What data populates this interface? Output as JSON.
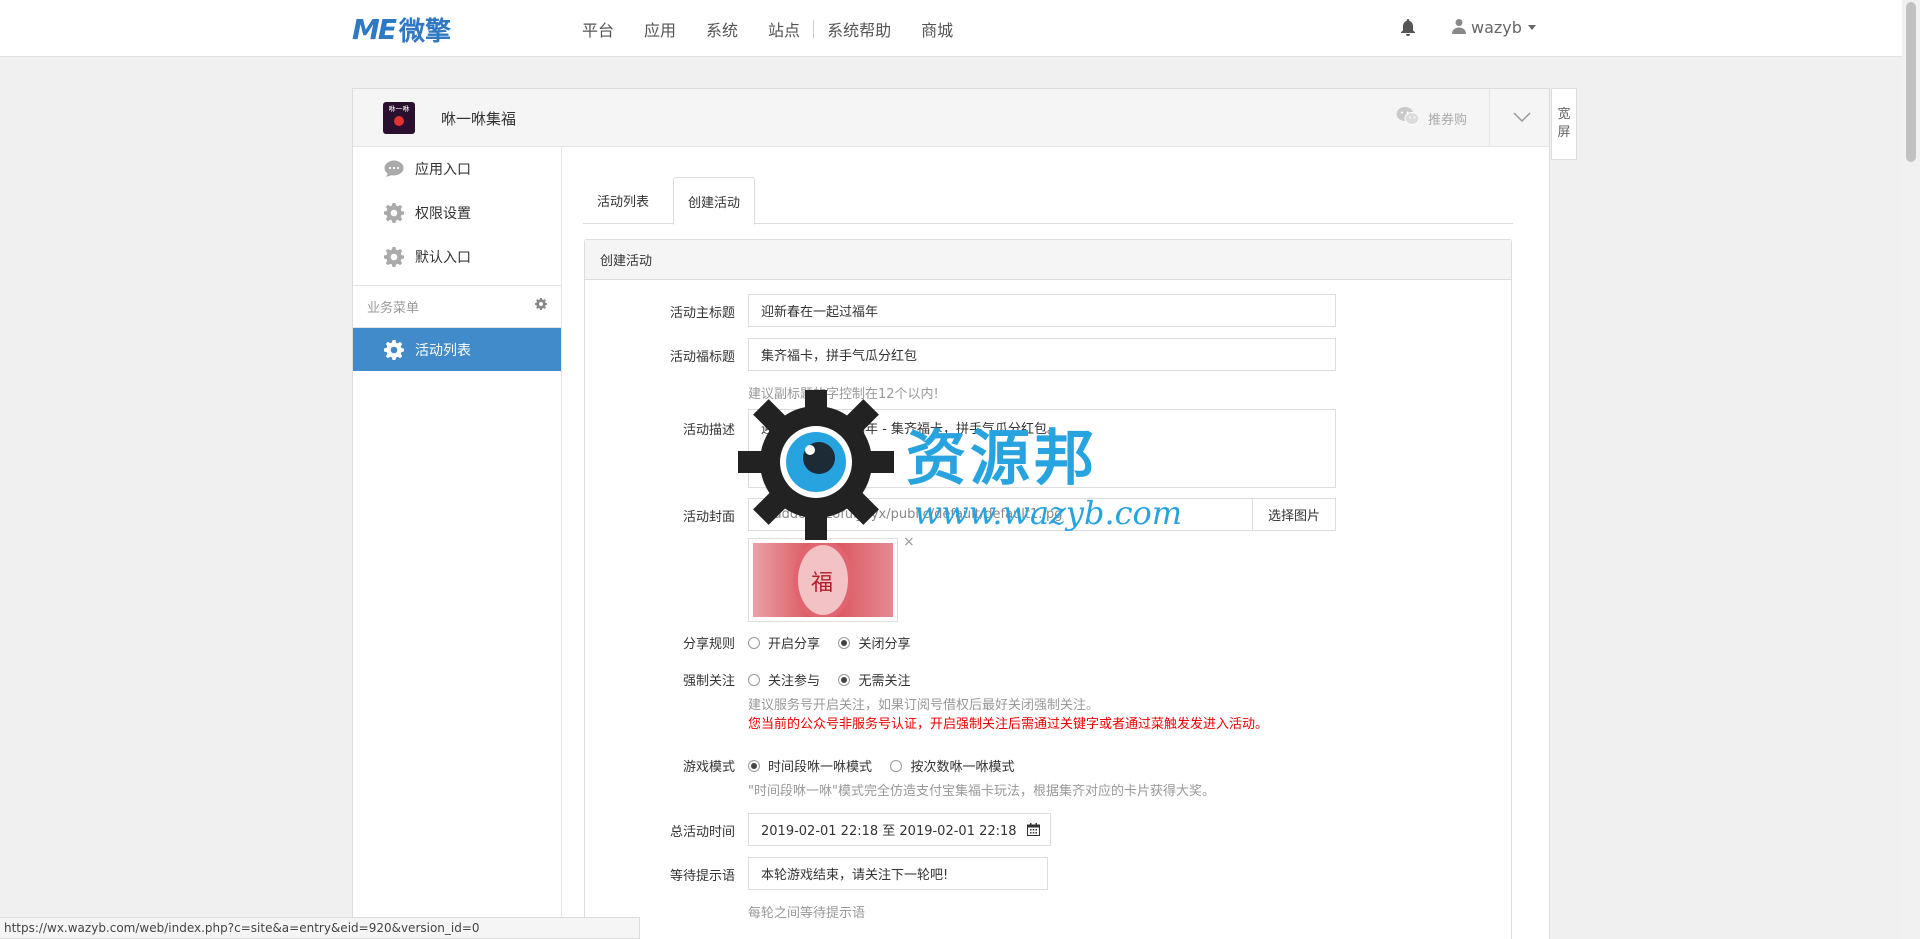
{
  "brand": {
    "mark": "ME",
    "name": "微擎"
  },
  "nav": [
    "平台",
    "应用",
    "系统",
    "站点",
    "系统帮助",
    "商城"
  ],
  "user": {
    "name": "wazyb"
  },
  "app": {
    "title": "咻一咻集福",
    "icon_text": "咻一咻",
    "recommend": "推券购"
  },
  "wide_screen": [
    "宽",
    "屏"
  ],
  "sidebar": {
    "items": [
      {
        "label": "应用入口",
        "icon": "chat-icon"
      },
      {
        "label": "权限设置",
        "icon": "gear-icon"
      },
      {
        "label": "默认入口",
        "icon": "gear-icon"
      }
    ],
    "group_title": "业务菜单",
    "active_item": "活动列表"
  },
  "tabs": [
    "活动列表",
    "创建活动"
  ],
  "form": {
    "card_title": "创建活动",
    "main_title_label": "活动主标题",
    "main_title_value": "迎新春在一起过福年",
    "sub_title_label": "活动福标题",
    "sub_title_value": "集齐福卡，拼手气瓜分红包",
    "sub_title_help": "建议副标题的字控制在12个以内!",
    "desc_label": "活动描述",
    "desc_value": "迎新春在一起过福年 - 集齐福卡，拼手气瓜分红包。",
    "cover_label": "活动封面",
    "cover_value": "../addons/zofui_xyx/public/default/default1.jpg",
    "cover_button": "选择图片",
    "cover_image_text": "福",
    "share_label": "分享规则",
    "share_options": [
      "开启分享",
      "关闭分享"
    ],
    "share_selected": 1,
    "follow_label": "强制关注",
    "follow_options": [
      "关注参与",
      "无需关注"
    ],
    "follow_selected": 1,
    "follow_help": "建议服务号开启关注，如果订阅号借权后最好关闭强制关注。",
    "follow_warning": "您当前的公众号非服务号认证，开启强制关注后需通过关键字或者通过菜触发发进入活动。",
    "mode_label": "游戏模式",
    "mode_options": [
      "时间段咻一咻模式",
      "按次数咻一咻模式"
    ],
    "mode_selected": 0,
    "mode_help": "\"时间段咻一咻\"模式完全仿造支付宝集福卡玩法，根据集齐对应的卡片获得大奖。",
    "time_label": "总活动时间",
    "time_value": "2019-02-01 22:18 至 2019-02-01 22:18",
    "wait_label": "等待提示语",
    "wait_value": "本轮游戏结束，请关注下一轮吧!",
    "wait_help": "每轮之间等待提示语"
  },
  "watermark": {
    "title": "资源邦",
    "url": "www.wazyb.com"
  },
  "status_url": "https://wx.wazyb.com/web/index.php?c=site&a=entry&eid=920&version_id=0",
  "colors": {
    "brand": "#2f78c4",
    "active": "#428bca",
    "warning": "#ee0000"
  }
}
